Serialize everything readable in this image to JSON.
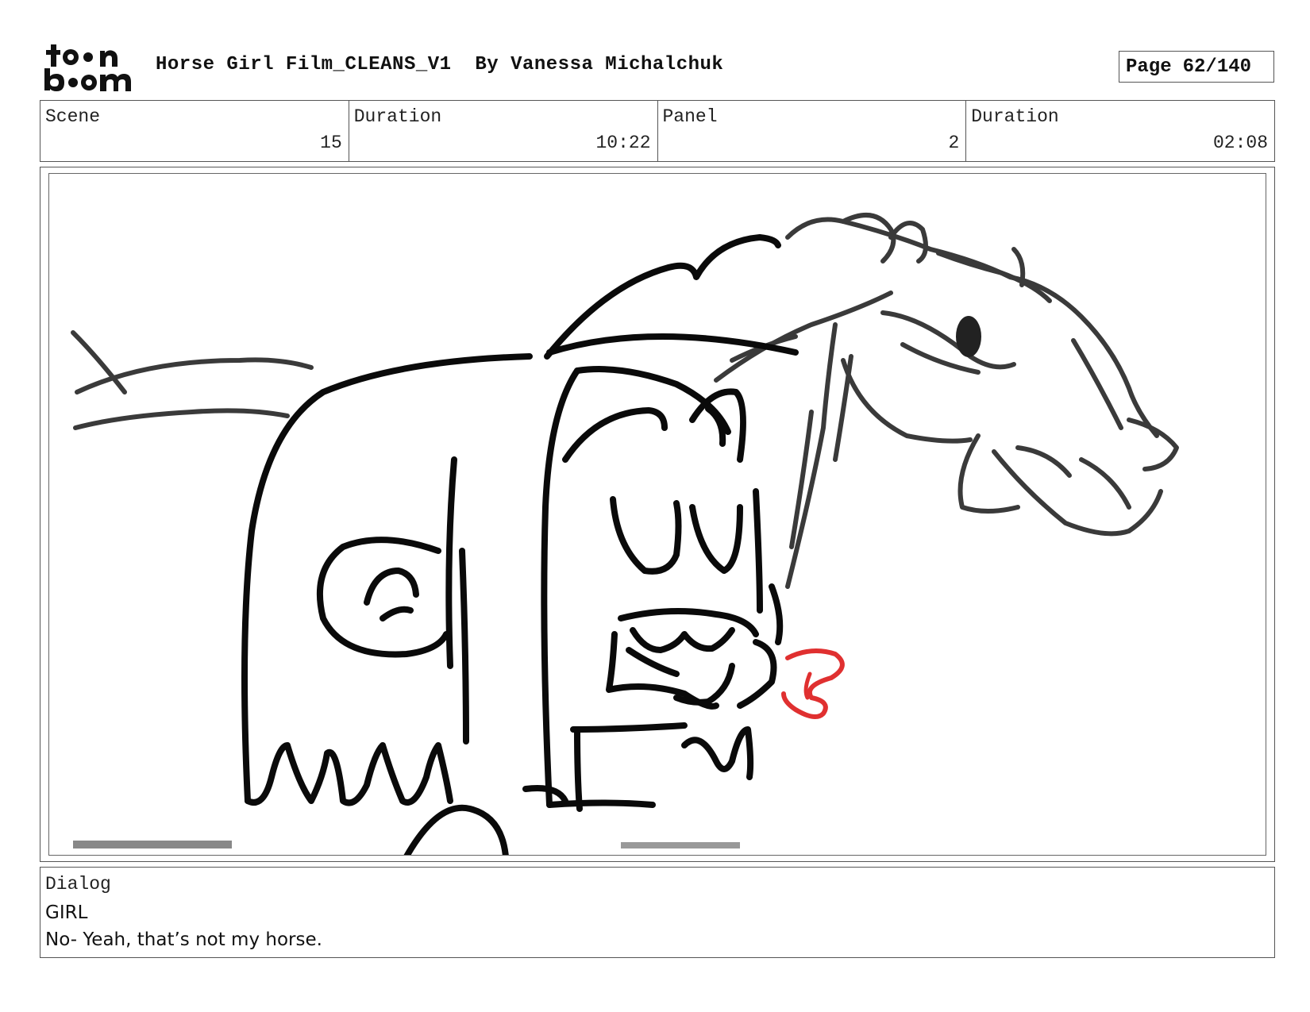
{
  "header": {
    "logo_text": "toon boom",
    "title": "Horse Girl Film_CLEANS_V1  By Vanessa Michalchuk",
    "page_label": "Page",
    "page_number": "62/140"
  },
  "meta": {
    "scene_label": "Scene",
    "scene_value": "15",
    "scene_duration_label": "Duration",
    "scene_duration_value": "10:22",
    "panel_label": "Panel",
    "panel_value": "2",
    "panel_duration_label": "Duration",
    "panel_duration_value": "02:08"
  },
  "panel_image": {
    "description_icon": "storyboard-sketch-image",
    "line_color": "#111111",
    "sketch_color": "#333333",
    "annotation_color": "#e03030"
  },
  "dialog": {
    "label": "Dialog",
    "speaker": "GIRL",
    "text": "No- Yeah, that’s not my horse."
  }
}
